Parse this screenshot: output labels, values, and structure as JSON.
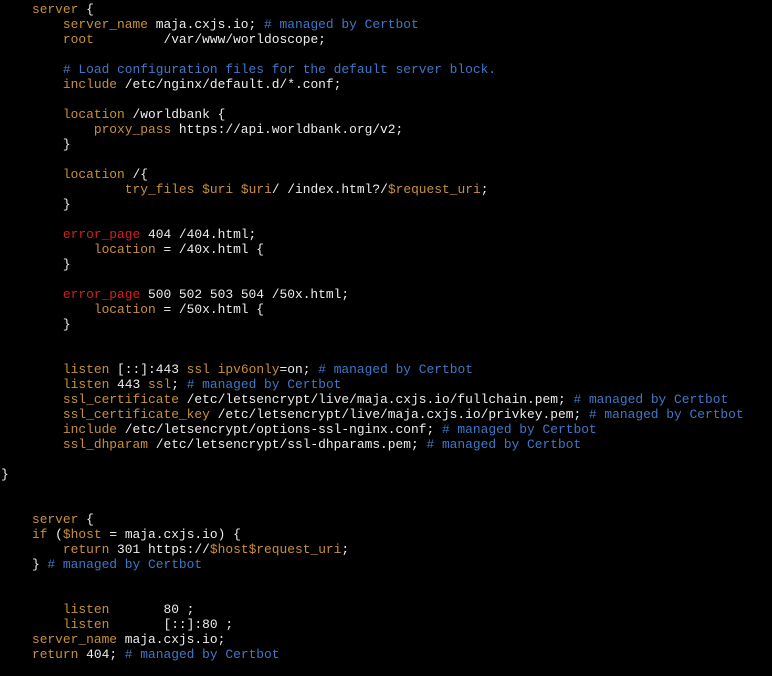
{
  "colors": {
    "background": "#000000",
    "text": "#ececec",
    "keyword": "#c8903a",
    "comment": "#3d78c8",
    "error_directive": "#d22020",
    "variable": "#c8903a"
  },
  "lines": [
    [
      {
        "t": "    "
      },
      {
        "k": "kw",
        "t": "server"
      },
      {
        "t": " {"
      }
    ],
    [
      {
        "t": "        "
      },
      {
        "k": "kw",
        "t": "server_name"
      },
      {
        "t": " maja.cxjs.io; "
      },
      {
        "k": "cmt",
        "t": "# managed by Certbot"
      }
    ],
    [
      {
        "t": "        "
      },
      {
        "k": "kw",
        "t": "root"
      },
      {
        "t": "         /var/www/worldoscope;"
      }
    ],
    [],
    [
      {
        "t": "        "
      },
      {
        "k": "cmt",
        "t": "# Load configuration files for the default server block."
      }
    ],
    [
      {
        "t": "        "
      },
      {
        "k": "kw",
        "t": "include"
      },
      {
        "t": " /etc/nginx/default.d/*.conf;"
      }
    ],
    [],
    [
      {
        "t": "        "
      },
      {
        "k": "kw",
        "t": "location"
      },
      {
        "t": " /worldbank {"
      }
    ],
    [
      {
        "t": "            "
      },
      {
        "k": "kw",
        "t": "proxy_pass"
      },
      {
        "t": " https://api.worldbank.org/v2;"
      }
    ],
    [
      {
        "t": "        }"
      }
    ],
    [],
    [
      {
        "t": "        "
      },
      {
        "k": "kw",
        "t": "location"
      },
      {
        "t": " /{"
      }
    ],
    [
      {
        "t": "                "
      },
      {
        "k": "kw",
        "t": "try_files"
      },
      {
        "t": " "
      },
      {
        "k": "var",
        "t": "$uri"
      },
      {
        "t": " "
      },
      {
        "k": "var",
        "t": "$uri"
      },
      {
        "t": "/ /index.html?/"
      },
      {
        "k": "var",
        "t": "$request_uri"
      },
      {
        "t": ";"
      }
    ],
    [
      {
        "t": "        }"
      }
    ],
    [],
    [
      {
        "t": "        "
      },
      {
        "k": "err",
        "t": "error_page"
      },
      {
        "t": " 404 /404.html;"
      }
    ],
    [
      {
        "t": "            "
      },
      {
        "k": "kw",
        "t": "location"
      },
      {
        "t": " = /40x.html {"
      }
    ],
    [
      {
        "t": "        }"
      }
    ],
    [],
    [
      {
        "t": "        "
      },
      {
        "k": "err",
        "t": "error_page"
      },
      {
        "t": " 500 502 503 504 /50x.html;"
      }
    ],
    [
      {
        "t": "            "
      },
      {
        "k": "kw",
        "t": "location"
      },
      {
        "t": " = /50x.html {"
      }
    ],
    [
      {
        "t": "        }"
      }
    ],
    [],
    [],
    [
      {
        "t": "        "
      },
      {
        "k": "kw",
        "t": "listen"
      },
      {
        "t": " [::]:443 "
      },
      {
        "k": "kw",
        "t": "ssl"
      },
      {
        "t": " "
      },
      {
        "k": "kw",
        "t": "ipv6only"
      },
      {
        "t": "=on; "
      },
      {
        "k": "cmt",
        "t": "# managed by Certbot"
      }
    ],
    [
      {
        "t": "        "
      },
      {
        "k": "kw",
        "t": "listen"
      },
      {
        "t": " 443 "
      },
      {
        "k": "kw",
        "t": "ssl"
      },
      {
        "t": "; "
      },
      {
        "k": "cmt",
        "t": "# managed by Certbot"
      }
    ],
    [
      {
        "t": "        "
      },
      {
        "k": "kw",
        "t": "ssl_certificate"
      },
      {
        "t": " /etc/letsencrypt/live/maja.cxjs.io/fullchain.pem; "
      },
      {
        "k": "cmt",
        "t": "# managed by Certbot"
      }
    ],
    [
      {
        "t": "        "
      },
      {
        "k": "kw",
        "t": "ssl_certificate_key"
      },
      {
        "t": " /etc/letsencrypt/live/maja.cxjs.io/privkey.pem; "
      },
      {
        "k": "cmt",
        "t": "# managed by Certbot"
      }
    ],
    [
      {
        "t": "        "
      },
      {
        "k": "kw",
        "t": "include"
      },
      {
        "t": " /etc/letsencrypt/options-ssl-nginx.conf; "
      },
      {
        "k": "cmt",
        "t": "# managed by Certbot"
      }
    ],
    [
      {
        "t": "        "
      },
      {
        "k": "kw",
        "t": "ssl_dhparam"
      },
      {
        "t": " /etc/letsencrypt/ssl-dhparams.pem; "
      },
      {
        "k": "cmt",
        "t": "# managed by Certbot"
      }
    ],
    [],
    [
      {
        "t": "}"
      }
    ],
    [],
    [],
    [
      {
        "t": "    "
      },
      {
        "k": "kw",
        "t": "server"
      },
      {
        "t": " {"
      }
    ],
    [
      {
        "t": "    "
      },
      {
        "k": "kw",
        "t": "if"
      },
      {
        "t": " ("
      },
      {
        "k": "var",
        "t": "$host"
      },
      {
        "t": " = maja.cxjs.io) {"
      }
    ],
    [
      {
        "t": "        "
      },
      {
        "k": "kw",
        "t": "return"
      },
      {
        "t": " 301 https://"
      },
      {
        "k": "var",
        "t": "$host$request_uri"
      },
      {
        "t": ";"
      }
    ],
    [
      {
        "t": "    } "
      },
      {
        "k": "cmt",
        "t": "# managed by Certbot"
      }
    ],
    [],
    [],
    [
      {
        "t": "        "
      },
      {
        "k": "kw",
        "t": "listen"
      },
      {
        "t": "       80 ;"
      }
    ],
    [
      {
        "t": "        "
      },
      {
        "k": "kw",
        "t": "listen"
      },
      {
        "t": "       [::]:80 ;"
      }
    ],
    [
      {
        "t": "    "
      },
      {
        "k": "kw",
        "t": "server_name"
      },
      {
        "t": " maja.cxjs.io;"
      }
    ],
    [
      {
        "t": "    "
      },
      {
        "k": "kw",
        "t": "return"
      },
      {
        "t": " 404; "
      },
      {
        "k": "cmt",
        "t": "# managed by Certbot"
      }
    ],
    [],
    [
      {
        "t": "}"
      }
    ]
  ]
}
